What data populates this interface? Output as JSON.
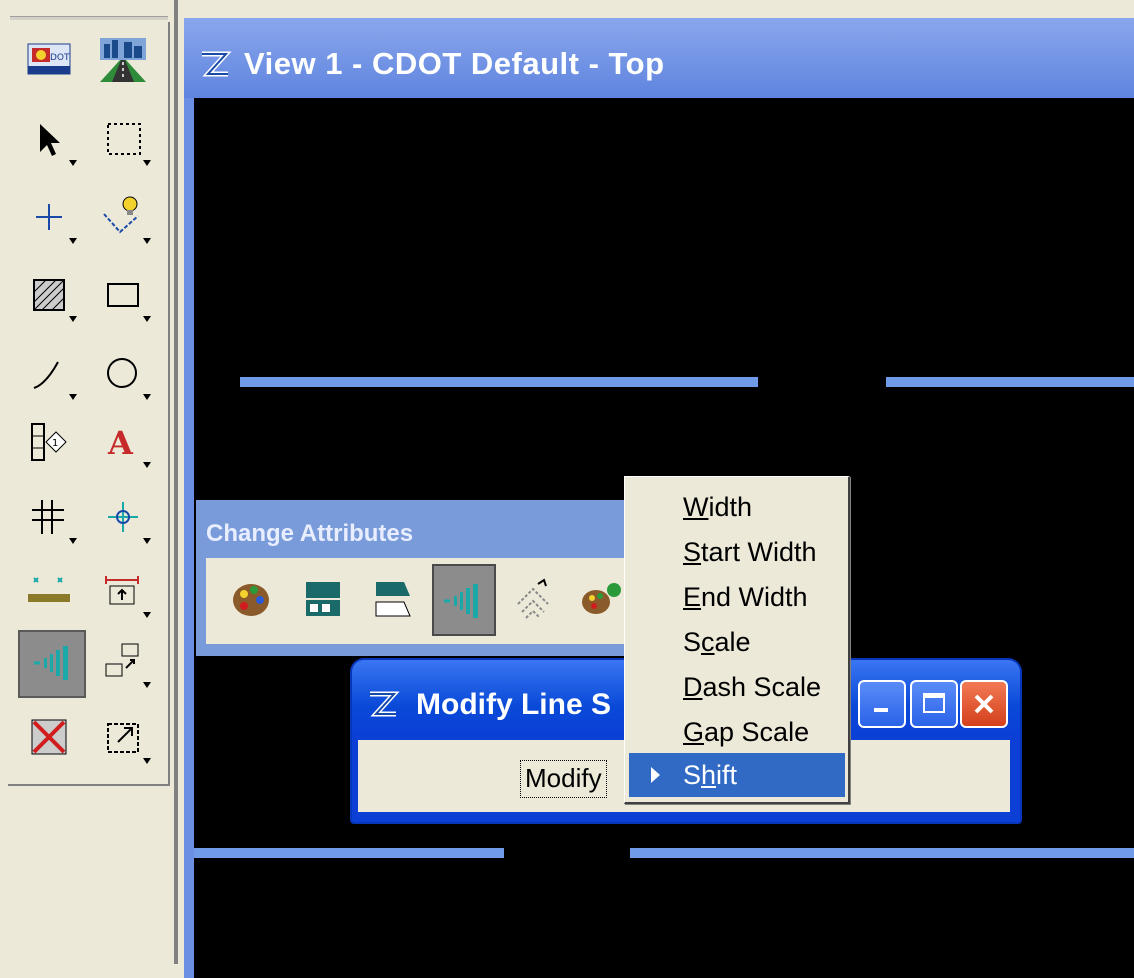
{
  "view_window": {
    "title": "View 1 - CDOT Default - Top"
  },
  "change_attributes": {
    "title": "Change Attributes",
    "tools": [
      "palette-icon",
      "line-style-icon",
      "line-weight-icon",
      "modify-line-style-icon",
      "pattern-icon",
      "color-icon"
    ]
  },
  "modify_dialog": {
    "title": "Modify Line S",
    "button_label": "Modify"
  },
  "context_menu": {
    "items": [
      {
        "label": "Width",
        "mnemonic": "W"
      },
      {
        "label": "Start Width",
        "mnemonic": "S"
      },
      {
        "label": "End Width",
        "mnemonic": "E"
      },
      {
        "label": "Scale",
        "mnemonic": "c"
      },
      {
        "label": "Dash Scale",
        "mnemonic": "D"
      },
      {
        "label": "Gap Scale",
        "mnemonic": "G"
      },
      {
        "label": "Shift",
        "mnemonic": "h",
        "selected": true
      }
    ]
  },
  "palette": {
    "tools": [
      "cdot-logo-icon",
      "roadway-icon",
      "select-arrow-icon",
      "fence-icon",
      "point-icon",
      "snap-icon",
      "hatch-icon",
      "rectangle-icon",
      "arc-icon",
      "circle-icon",
      "cell-icon",
      "text-icon",
      "grid-icon",
      "measure-icon",
      "dimension-icon",
      "annotate-icon",
      "modify-line-style-icon",
      "transform-icon",
      "delete-icon",
      "view-icon"
    ]
  },
  "colors": {
    "canvas": "#000000",
    "line": "#6f9be8",
    "title_bar": "#0b3fd6",
    "selection": "#316ac5"
  }
}
